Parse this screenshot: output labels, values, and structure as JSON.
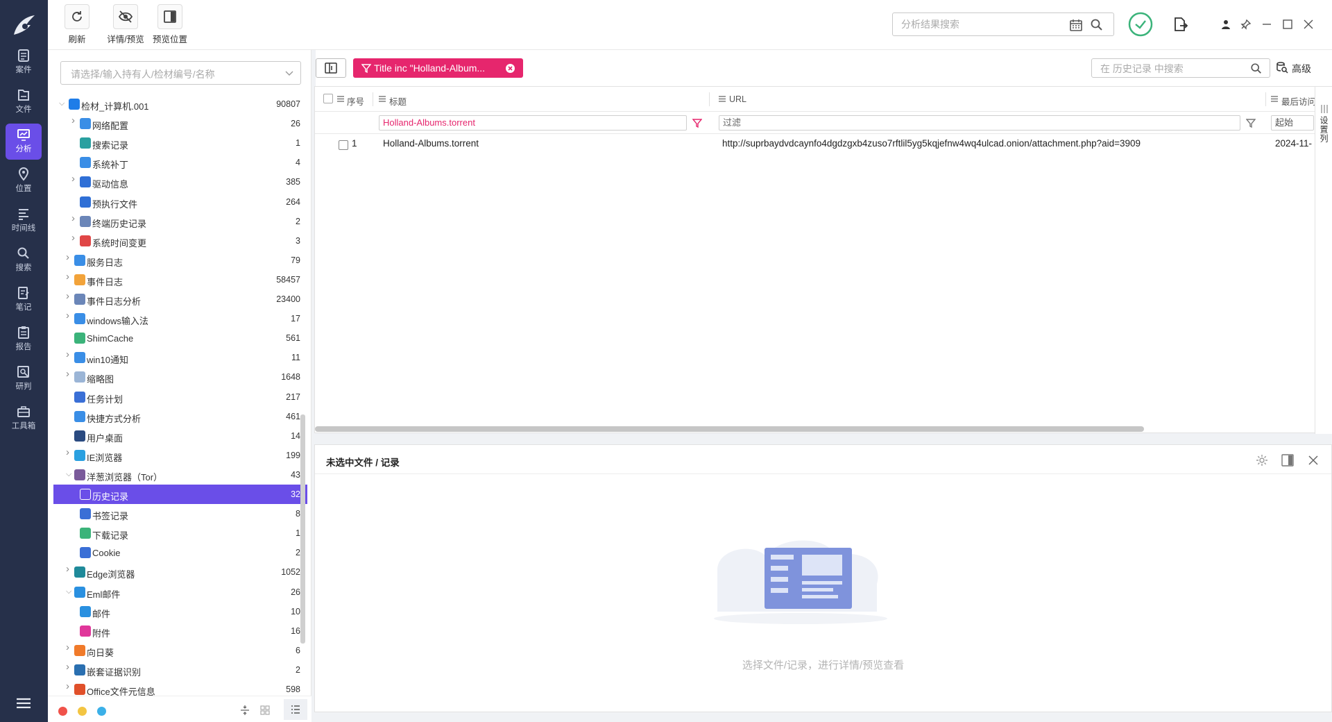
{
  "nav": {
    "items": [
      {
        "label": "案件",
        "icon": "case-icon"
      },
      {
        "label": "文件",
        "icon": "file-icon"
      },
      {
        "label": "分析",
        "icon": "analysis-icon"
      },
      {
        "label": "位置",
        "icon": "location-icon"
      },
      {
        "label": "时间线",
        "icon": "timeline-icon"
      },
      {
        "label": "搜索",
        "icon": "search-icon"
      },
      {
        "label": "笔记",
        "icon": "note-icon"
      },
      {
        "label": "报告",
        "icon": "report-icon"
      },
      {
        "label": "研判",
        "icon": "judge-icon"
      },
      {
        "label": "工具箱",
        "icon": "toolbox-icon"
      }
    ],
    "active": "分析"
  },
  "toolbar": {
    "refresh_label": "刷新",
    "detail_preview_label": "详情/预览",
    "preview_position_label": "预览位置",
    "search_placeholder": "分析结果搜索"
  },
  "tree": {
    "evidence_placeholder": "请选择/输入持有人/检材编号/名称",
    "items": [
      {
        "label": "检材_计算机.001",
        "count": "90807",
        "icon_color": "#1f7de8"
      },
      {
        "label": "网络配置",
        "count": "26",
        "icon_color": "#3a8ee6"
      },
      {
        "label": "搜索记录",
        "count": "1",
        "icon_color": "#29a0a0"
      },
      {
        "label": "系统补丁",
        "count": "4",
        "icon_color": "#3a8ee6"
      },
      {
        "label": "驱动信息",
        "count": "385",
        "icon_color": "#2f6fd6"
      },
      {
        "label": "预执行文件",
        "count": "264",
        "icon_color": "#2f6fd6"
      },
      {
        "label": "终端历史记录",
        "count": "2",
        "icon_color": "#6b86b8"
      },
      {
        "label": "系统时间变更",
        "count": "3",
        "icon_color": "#e04646"
      },
      {
        "label": "服务日志",
        "count": "79",
        "icon_color": "#3a8ee6"
      },
      {
        "label": "事件日志",
        "count": "58457",
        "icon_color": "#f2a33a"
      },
      {
        "label": "事件日志分析",
        "count": "23400",
        "icon_color": "#6b86b8"
      },
      {
        "label": "windows输入法",
        "count": "17",
        "icon_color": "#3a8ee6"
      },
      {
        "label": "ShimCache",
        "count": "561",
        "icon_color": "#3bb37a"
      },
      {
        "label": "win10通知",
        "count": "11",
        "icon_color": "#3a8ee6"
      },
      {
        "label": "缩略图",
        "count": "1648",
        "icon_color": "#9bb5d6"
      },
      {
        "label": "任务计划",
        "count": "217",
        "icon_color": "#3a6fd6"
      },
      {
        "label": "快捷方式分析",
        "count": "461",
        "icon_color": "#3a8ee6"
      },
      {
        "label": "用户桌面",
        "count": "14",
        "icon_color": "#2a4a80"
      },
      {
        "label": "IE浏览器",
        "count": "199",
        "icon_color": "#2aa0e0"
      },
      {
        "label": "洋葱浏览器（Tor）",
        "count": "43",
        "icon_color": "#7a5a9a"
      },
      {
        "label": "历史记录",
        "count": "32",
        "icon_color": "#ffffff"
      },
      {
        "label": "书签记录",
        "count": "8",
        "icon_color": "#3a6fd6"
      },
      {
        "label": "下载记录",
        "count": "1",
        "icon_color": "#3bb37a"
      },
      {
        "label": "Cookie",
        "count": "2",
        "icon_color": "#3a6fd6"
      },
      {
        "label": "Edge浏览器",
        "count": "1052",
        "icon_color": "#1f8a9a"
      },
      {
        "label": "Eml邮件",
        "count": "26",
        "icon_color": "#2a90e0"
      },
      {
        "label": "邮件",
        "count": "10",
        "icon_color": "#2a90e0"
      },
      {
        "label": "附件",
        "count": "16",
        "icon_color": "#e0369a"
      },
      {
        "label": "向日葵",
        "count": "6",
        "icon_color": "#f07a2a"
      },
      {
        "label": "嵌套证据识别",
        "count": "2",
        "icon_color": "#2a6fb0"
      },
      {
        "label": "Office文件元信息",
        "count": "598",
        "icon_color": "#e0502a"
      }
    ],
    "selected": "历史记录"
  },
  "main": {
    "filter_chip_text": "Title inc \"Holland-Album...",
    "history_search_placeholder": "在 历史记录 中搜索",
    "advanced_label": "高级",
    "columns": {
      "index": "序号",
      "title": "标题",
      "url": "URL",
      "last_visit": "最后访问"
    },
    "filters": {
      "title_value": "Holland-Albums.torrent",
      "url_placeholder": "过滤",
      "date_placeholder": "起始"
    },
    "rows": [
      {
        "index": "1",
        "title": "Holland-Albums.torrent",
        "url": "http://suprbaydvdcaynfo4dgdzgxb4zuso7rftlil5yg5kqjefnw4wq4ulcad.onion/attachment.php?aid=3909",
        "last_visit": "2024-11-"
      }
    ],
    "column_settings_label": "设置列"
  },
  "detail": {
    "title": "未选中文件 / 记录",
    "empty_hint": "选择文件/记录，进行详情/预览查看"
  },
  "colors": {
    "accent": "#6a4ee8",
    "nav_bg": "#26304a",
    "chip": "#e6266d",
    "ok_green": "#3bb37a"
  }
}
